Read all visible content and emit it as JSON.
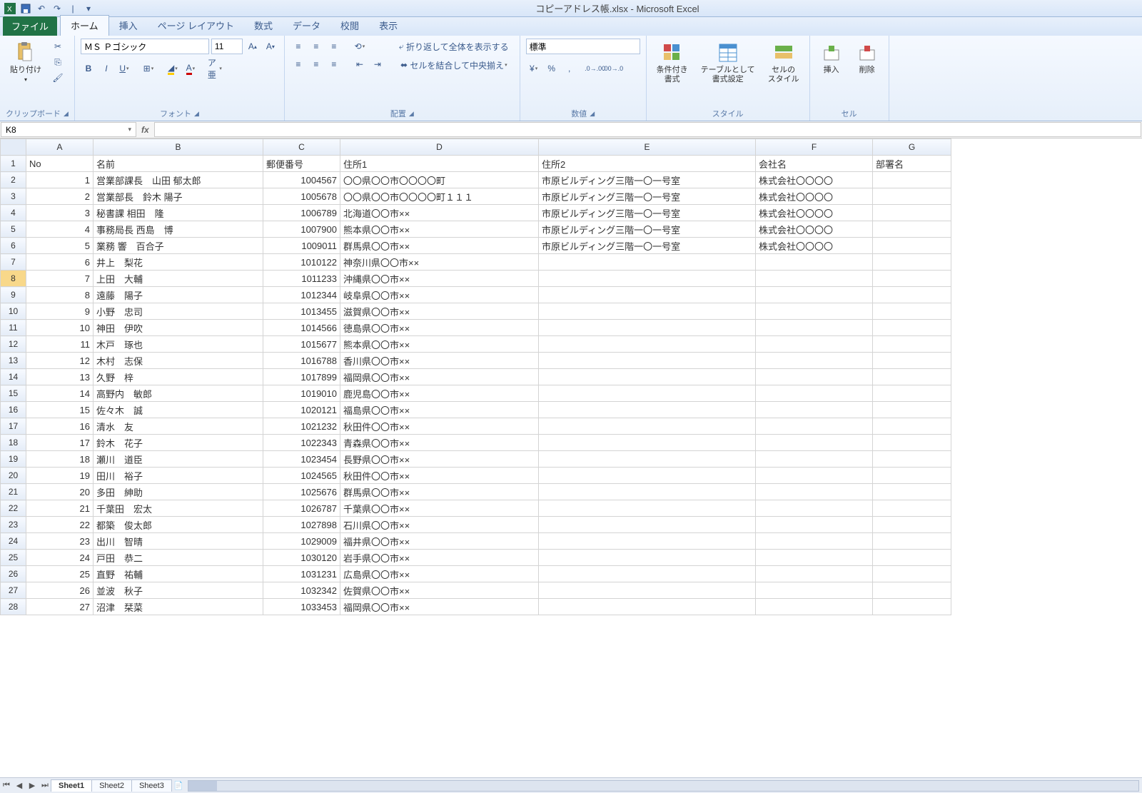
{
  "title": "コピーアドレス帳.xlsx - Microsoft Excel",
  "tabs": {
    "file": "ファイル",
    "home": "ホーム",
    "insert": "挿入",
    "page_layout": "ページ レイアウト",
    "formulas": "数式",
    "data": "データ",
    "review": "校閲",
    "view": "表示"
  },
  "ribbon": {
    "clipboard": {
      "label": "クリップボード",
      "paste": "貼り付け"
    },
    "font": {
      "label": "フォント",
      "name": "ＭＳ Ｐゴシック",
      "size": "11"
    },
    "alignment": {
      "label": "配置",
      "wrap": "折り返して全体を表示する",
      "merge": "セルを結合して中央揃え"
    },
    "number": {
      "label": "数値",
      "format": "標準"
    },
    "styles": {
      "label": "スタイル",
      "conditional": "条件付き\n書式",
      "table": "テーブルとして\n書式設定",
      "cell": "セルの\nスタイル"
    },
    "cells": {
      "label": "セル",
      "insert": "挿入",
      "delete": "削除"
    }
  },
  "namebox": "K8",
  "formula": "",
  "columns": [
    "A",
    "B",
    "C",
    "D",
    "E",
    "F",
    "G"
  ],
  "headers": {
    "A": "No",
    "B": "名前",
    "C": "郵便番号",
    "D": "住所1",
    "E": "住所2",
    "F": "会社名",
    "G": "部署名"
  },
  "selected_row": 8,
  "rows": [
    {
      "n": 1,
      "A": "1",
      "B": "営業部課長　山田 郁太郎",
      "C": "1004567",
      "D": "〇〇県〇〇市〇〇〇〇町",
      "E": "市原ビルディング三階一〇一号室",
      "F": "株式会社〇〇〇〇",
      "G": ""
    },
    {
      "n": 2,
      "A": "2",
      "B": "営業部長　鈴木 陽子",
      "C": "1005678",
      "D": "〇〇県〇〇市〇〇〇〇町１１１",
      "E": "市原ビルディング三階一〇一号室",
      "F": "株式会社〇〇〇〇",
      "G": ""
    },
    {
      "n": 3,
      "A": "3",
      "B": "秘書課 相田　隆",
      "C": "1006789",
      "D": "北海道〇〇市××",
      "E": "市原ビルディング三階一〇一号室",
      "F": "株式会社〇〇〇〇",
      "G": ""
    },
    {
      "n": 4,
      "A": "4",
      "B": "事務局長 西島　博",
      "C": "1007900",
      "D": "熊本県〇〇市××",
      "E": "市原ビルディング三階一〇一号室",
      "F": "株式会社〇〇〇〇",
      "G": ""
    },
    {
      "n": 5,
      "A": "5",
      "B": "業務 響　百合子",
      "C": "1009011",
      "D": "群馬県〇〇市××",
      "E": "市原ビルディング三階一〇一号室",
      "F": "株式会社〇〇〇〇",
      "G": ""
    },
    {
      "n": 6,
      "A": "6",
      "B": "井上　梨花",
      "C": "1010122",
      "D": "神奈川県〇〇市××",
      "E": "",
      "F": "",
      "G": ""
    },
    {
      "n": 7,
      "A": "7",
      "B": "上田　大輔",
      "C": "1011233",
      "D": "沖縄県〇〇市××",
      "E": "",
      "F": "",
      "G": ""
    },
    {
      "n": 8,
      "A": "8",
      "B": "遠藤　陽子",
      "C": "1012344",
      "D": "岐阜県〇〇市××",
      "E": "",
      "F": "",
      "G": ""
    },
    {
      "n": 9,
      "A": "9",
      "B": "小野　忠司",
      "C": "1013455",
      "D": "滋賀県〇〇市××",
      "E": "",
      "F": "",
      "G": ""
    },
    {
      "n": 10,
      "A": "10",
      "B": "神田　伊吹",
      "C": "1014566",
      "D": "徳島県〇〇市××",
      "E": "",
      "F": "",
      "G": ""
    },
    {
      "n": 11,
      "A": "11",
      "B": "木戸　琢也",
      "C": "1015677",
      "D": "熊本県〇〇市××",
      "E": "",
      "F": "",
      "G": ""
    },
    {
      "n": 12,
      "A": "12",
      "B": "木村　志保",
      "C": "1016788",
      "D": "香川県〇〇市××",
      "E": "",
      "F": "",
      "G": ""
    },
    {
      "n": 13,
      "A": "13",
      "B": "久野　梓",
      "C": "1017899",
      "D": "福岡県〇〇市××",
      "E": "",
      "F": "",
      "G": ""
    },
    {
      "n": 14,
      "A": "14",
      "B": "高野内　敏郎",
      "C": "1019010",
      "D": "鹿児島〇〇市××",
      "E": "",
      "F": "",
      "G": ""
    },
    {
      "n": 15,
      "A": "15",
      "B": "佐々木　誠",
      "C": "1020121",
      "D": "福島県〇〇市××",
      "E": "",
      "F": "",
      "G": ""
    },
    {
      "n": 16,
      "A": "16",
      "B": "清水　友",
      "C": "1021232",
      "D": "秋田件〇〇市××",
      "E": "",
      "F": "",
      "G": ""
    },
    {
      "n": 17,
      "A": "17",
      "B": "鈴木　花子",
      "C": "1022343",
      "D": "青森県〇〇市××",
      "E": "",
      "F": "",
      "G": ""
    },
    {
      "n": 18,
      "A": "18",
      "B": "瀬川　道臣",
      "C": "1023454",
      "D": "長野県〇〇市××",
      "E": "",
      "F": "",
      "G": ""
    },
    {
      "n": 19,
      "A": "19",
      "B": "田川　裕子",
      "C": "1024565",
      "D": "秋田件〇〇市××",
      "E": "",
      "F": "",
      "G": ""
    },
    {
      "n": 20,
      "A": "20",
      "B": "多田　紳助",
      "C": "1025676",
      "D": "群馬県〇〇市××",
      "E": "",
      "F": "",
      "G": ""
    },
    {
      "n": 21,
      "A": "21",
      "B": "千葉田　宏太",
      "C": "1026787",
      "D": "千葉県〇〇市××",
      "E": "",
      "F": "",
      "G": ""
    },
    {
      "n": 22,
      "A": "22",
      "B": "都築　俊太郎",
      "C": "1027898",
      "D": "石川県〇〇市××",
      "E": "",
      "F": "",
      "G": ""
    },
    {
      "n": 23,
      "A": "23",
      "B": "出川　智晴",
      "C": "1029009",
      "D": "福井県〇〇市××",
      "E": "",
      "F": "",
      "G": ""
    },
    {
      "n": 24,
      "A": "24",
      "B": "戸田　恭二",
      "C": "1030120",
      "D": "岩手県〇〇市××",
      "E": "",
      "F": "",
      "G": ""
    },
    {
      "n": 25,
      "A": "25",
      "B": "直野　祐輔",
      "C": "1031231",
      "D": "広島県〇〇市××",
      "E": "",
      "F": "",
      "G": ""
    },
    {
      "n": 26,
      "A": "26",
      "B": "並波　秋子",
      "C": "1032342",
      "D": "佐賀県〇〇市××",
      "E": "",
      "F": "",
      "G": ""
    },
    {
      "n": 27,
      "A": "27",
      "B": "沼津　栞菜",
      "C": "1033453",
      "D": "福岡県〇〇市××",
      "E": "",
      "F": "",
      "G": ""
    }
  ],
  "sheets": [
    "Sheet1",
    "Sheet2",
    "Sheet3"
  ],
  "active_sheet": 0
}
